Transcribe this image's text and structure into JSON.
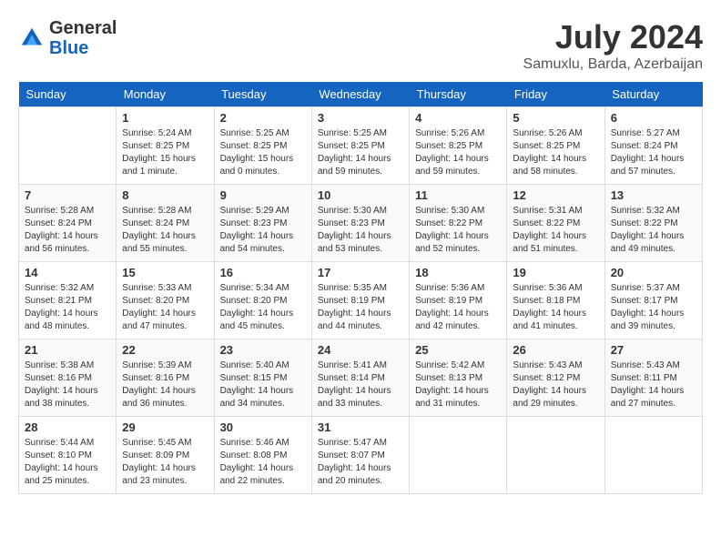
{
  "header": {
    "logo_general": "General",
    "logo_blue": "Blue",
    "month_title": "July 2024",
    "location": "Samuxlu, Barda, Azerbaijan"
  },
  "weekdays": [
    "Sunday",
    "Monday",
    "Tuesday",
    "Wednesday",
    "Thursday",
    "Friday",
    "Saturday"
  ],
  "weeks": [
    [
      {
        "day": "",
        "sunrise": "",
        "sunset": "",
        "daylight": ""
      },
      {
        "day": "1",
        "sunrise": "Sunrise: 5:24 AM",
        "sunset": "Sunset: 8:25 PM",
        "daylight": "Daylight: 15 hours and 1 minute."
      },
      {
        "day": "2",
        "sunrise": "Sunrise: 5:25 AM",
        "sunset": "Sunset: 8:25 PM",
        "daylight": "Daylight: 15 hours and 0 minutes."
      },
      {
        "day": "3",
        "sunrise": "Sunrise: 5:25 AM",
        "sunset": "Sunset: 8:25 PM",
        "daylight": "Daylight: 14 hours and 59 minutes."
      },
      {
        "day": "4",
        "sunrise": "Sunrise: 5:26 AM",
        "sunset": "Sunset: 8:25 PM",
        "daylight": "Daylight: 14 hours and 59 minutes."
      },
      {
        "day": "5",
        "sunrise": "Sunrise: 5:26 AM",
        "sunset": "Sunset: 8:25 PM",
        "daylight": "Daylight: 14 hours and 58 minutes."
      },
      {
        "day": "6",
        "sunrise": "Sunrise: 5:27 AM",
        "sunset": "Sunset: 8:24 PM",
        "daylight": "Daylight: 14 hours and 57 minutes."
      }
    ],
    [
      {
        "day": "7",
        "sunrise": "Sunrise: 5:28 AM",
        "sunset": "Sunset: 8:24 PM",
        "daylight": "Daylight: 14 hours and 56 minutes."
      },
      {
        "day": "8",
        "sunrise": "Sunrise: 5:28 AM",
        "sunset": "Sunset: 8:24 PM",
        "daylight": "Daylight: 14 hours and 55 minutes."
      },
      {
        "day": "9",
        "sunrise": "Sunrise: 5:29 AM",
        "sunset": "Sunset: 8:23 PM",
        "daylight": "Daylight: 14 hours and 54 minutes."
      },
      {
        "day": "10",
        "sunrise": "Sunrise: 5:30 AM",
        "sunset": "Sunset: 8:23 PM",
        "daylight": "Daylight: 14 hours and 53 minutes."
      },
      {
        "day": "11",
        "sunrise": "Sunrise: 5:30 AM",
        "sunset": "Sunset: 8:22 PM",
        "daylight": "Daylight: 14 hours and 52 minutes."
      },
      {
        "day": "12",
        "sunrise": "Sunrise: 5:31 AM",
        "sunset": "Sunset: 8:22 PM",
        "daylight": "Daylight: 14 hours and 51 minutes."
      },
      {
        "day": "13",
        "sunrise": "Sunrise: 5:32 AM",
        "sunset": "Sunset: 8:22 PM",
        "daylight": "Daylight: 14 hours and 49 minutes."
      }
    ],
    [
      {
        "day": "14",
        "sunrise": "Sunrise: 5:32 AM",
        "sunset": "Sunset: 8:21 PM",
        "daylight": "Daylight: 14 hours and 48 minutes."
      },
      {
        "day": "15",
        "sunrise": "Sunrise: 5:33 AM",
        "sunset": "Sunset: 8:20 PM",
        "daylight": "Daylight: 14 hours and 47 minutes."
      },
      {
        "day": "16",
        "sunrise": "Sunrise: 5:34 AM",
        "sunset": "Sunset: 8:20 PM",
        "daylight": "Daylight: 14 hours and 45 minutes."
      },
      {
        "day": "17",
        "sunrise": "Sunrise: 5:35 AM",
        "sunset": "Sunset: 8:19 PM",
        "daylight": "Daylight: 14 hours and 44 minutes."
      },
      {
        "day": "18",
        "sunrise": "Sunrise: 5:36 AM",
        "sunset": "Sunset: 8:19 PM",
        "daylight": "Daylight: 14 hours and 42 minutes."
      },
      {
        "day": "19",
        "sunrise": "Sunrise: 5:36 AM",
        "sunset": "Sunset: 8:18 PM",
        "daylight": "Daylight: 14 hours and 41 minutes."
      },
      {
        "day": "20",
        "sunrise": "Sunrise: 5:37 AM",
        "sunset": "Sunset: 8:17 PM",
        "daylight": "Daylight: 14 hours and 39 minutes."
      }
    ],
    [
      {
        "day": "21",
        "sunrise": "Sunrise: 5:38 AM",
        "sunset": "Sunset: 8:16 PM",
        "daylight": "Daylight: 14 hours and 38 minutes."
      },
      {
        "day": "22",
        "sunrise": "Sunrise: 5:39 AM",
        "sunset": "Sunset: 8:16 PM",
        "daylight": "Daylight: 14 hours and 36 minutes."
      },
      {
        "day": "23",
        "sunrise": "Sunrise: 5:40 AM",
        "sunset": "Sunset: 8:15 PM",
        "daylight": "Daylight: 14 hours and 34 minutes."
      },
      {
        "day": "24",
        "sunrise": "Sunrise: 5:41 AM",
        "sunset": "Sunset: 8:14 PM",
        "daylight": "Daylight: 14 hours and 33 minutes."
      },
      {
        "day": "25",
        "sunrise": "Sunrise: 5:42 AM",
        "sunset": "Sunset: 8:13 PM",
        "daylight": "Daylight: 14 hours and 31 minutes."
      },
      {
        "day": "26",
        "sunrise": "Sunrise: 5:43 AM",
        "sunset": "Sunset: 8:12 PM",
        "daylight": "Daylight: 14 hours and 29 minutes."
      },
      {
        "day": "27",
        "sunrise": "Sunrise: 5:43 AM",
        "sunset": "Sunset: 8:11 PM",
        "daylight": "Daylight: 14 hours and 27 minutes."
      }
    ],
    [
      {
        "day": "28",
        "sunrise": "Sunrise: 5:44 AM",
        "sunset": "Sunset: 8:10 PM",
        "daylight": "Daylight: 14 hours and 25 minutes."
      },
      {
        "day": "29",
        "sunrise": "Sunrise: 5:45 AM",
        "sunset": "Sunset: 8:09 PM",
        "daylight": "Daylight: 14 hours and 23 minutes."
      },
      {
        "day": "30",
        "sunrise": "Sunrise: 5:46 AM",
        "sunset": "Sunset: 8:08 PM",
        "daylight": "Daylight: 14 hours and 22 minutes."
      },
      {
        "day": "31",
        "sunrise": "Sunrise: 5:47 AM",
        "sunset": "Sunset: 8:07 PM",
        "daylight": "Daylight: 14 hours and 20 minutes."
      },
      {
        "day": "",
        "sunrise": "",
        "sunset": "",
        "daylight": ""
      },
      {
        "day": "",
        "sunrise": "",
        "sunset": "",
        "daylight": ""
      },
      {
        "day": "",
        "sunrise": "",
        "sunset": "",
        "daylight": ""
      }
    ]
  ]
}
